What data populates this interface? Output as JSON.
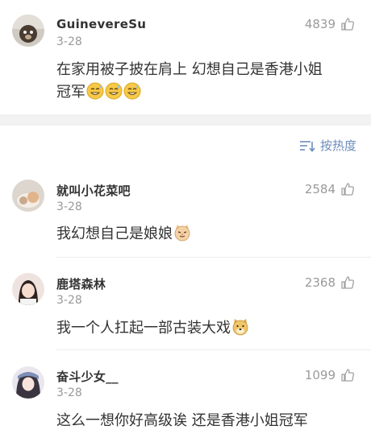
{
  "top_comment": {
    "username": "GuinevereSu",
    "date": "3-28",
    "likes": "4839",
    "text_line1": "在家用被子披在肩上 幻想自己是香港小姐",
    "text_line2": "冠军",
    "emoji": "grin-sweat-emoji"
  },
  "sort": {
    "label": "按热度",
    "icon": "sort-icon"
  },
  "comments": [
    {
      "username": "就叫小花菜吧",
      "date": "3-28",
      "likes": "2584",
      "text": "我幻想自己是娘娘",
      "emoji": "cat-emoji"
    },
    {
      "username": "鹿塔森林",
      "date": "3-28",
      "likes": "2368",
      "text": "我一个人扛起一部古装大戏",
      "emoji": "doge-emoji"
    },
    {
      "username": "奋斗少女__",
      "date": "3-28",
      "likes": "1099",
      "text": "这么一想你好高级诶 还是香港小姐冠军"
    }
  ],
  "colors": {
    "accent": "#6c8dbd",
    "muted": "#999999",
    "text": "#333333"
  }
}
